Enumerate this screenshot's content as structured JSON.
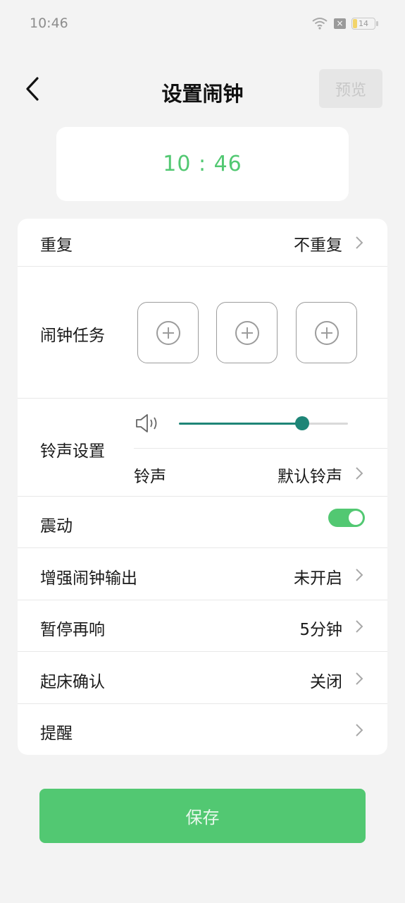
{
  "status_bar": {
    "time": "10:46",
    "battery_level": "14",
    "sim_icon": "×"
  },
  "header": {
    "title": "设置闹钟",
    "preview_label": "预览"
  },
  "alarm_time": "10 : 46",
  "settings": {
    "repeat": {
      "label": "重复",
      "value": "不重复"
    },
    "tasks": {
      "label": "闹钟任务",
      "slots": 3
    },
    "ringtone_section": {
      "label": "铃声设置",
      "volume_percent": 73,
      "ringtone_label": "铃声",
      "ringtone_value": "默认铃声"
    },
    "vibration": {
      "label": "震动",
      "on": true
    },
    "enhance_output": {
      "label": "增强闹钟输出",
      "value": "未开启"
    },
    "snooze": {
      "label": "暂停再响",
      "value": "5分钟"
    },
    "wake_confirm": {
      "label": "起床确认",
      "value": "关闭"
    },
    "reminder": {
      "label": "提醒",
      "value": ""
    }
  },
  "save_label": "保存",
  "colors": {
    "accent_green": "#52c872",
    "slider_teal": "#1e8577",
    "background": "#f3f3f3"
  },
  "icons": [
    "wifi-icon",
    "sim-icon",
    "battery-icon",
    "back-arrow-icon",
    "add-circle-icon",
    "volume-icon",
    "chevron-right-icon"
  ]
}
